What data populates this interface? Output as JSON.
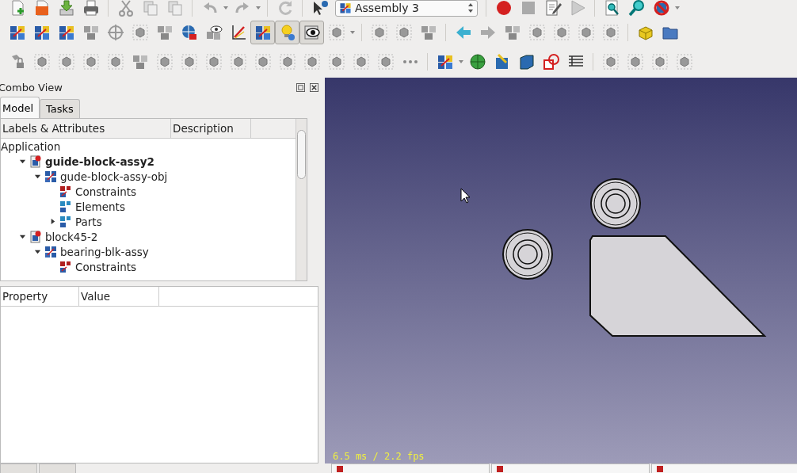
{
  "toolbars": [
    {
      "items": [
        {
          "kind": "new-document"
        },
        {
          "kind": "folder"
        },
        {
          "kind": "save"
        },
        {
          "kind": "printer"
        },
        {
          "kind": "separator"
        },
        {
          "kind": "scissors"
        },
        {
          "kind": "copy"
        },
        {
          "kind": "paste"
        },
        {
          "kind": "separator"
        },
        {
          "kind": "undo"
        },
        {
          "kind": "caret"
        },
        {
          "kind": "redo"
        },
        {
          "kind": "caret"
        },
        {
          "kind": "separator"
        },
        {
          "kind": "refresh"
        },
        {
          "kind": "separator"
        },
        {
          "kind": "pointer-question"
        },
        {
          "kind": "combo",
          "label": "Assembly 3"
        },
        {
          "kind": "separator"
        },
        {
          "kind": "record"
        },
        {
          "kind": "stop"
        },
        {
          "kind": "page-pencil"
        },
        {
          "kind": "play"
        },
        {
          "kind": "separator"
        },
        {
          "kind": "page-magnifier"
        },
        {
          "kind": "magnifier"
        },
        {
          "kind": "no-entry"
        },
        {
          "kind": "caret"
        }
      ]
    },
    {
      "items": [
        {
          "kind": "color-cubes",
          "pressed": false
        },
        {
          "kind": "color-cubes",
          "pressed": false
        },
        {
          "kind": "color-cubes",
          "pressed": false
        },
        {
          "kind": "gray-cubes",
          "pressed": false
        },
        {
          "kind": "crosshair",
          "pressed": false
        },
        {
          "kind": "gray-part",
          "pressed": false
        },
        {
          "kind": "gray-cubes",
          "pressed": false
        },
        {
          "kind": "globe-lock",
          "pressed": false
        },
        {
          "kind": "eye-cubes",
          "pressed": false
        },
        {
          "kind": "axis-pencil",
          "pressed": false
        },
        {
          "kind": "color-cubes",
          "pressed": true
        },
        {
          "kind": "bulb",
          "pressed": true
        },
        {
          "kind": "eye",
          "pressed": true
        },
        {
          "kind": "gray-part",
          "pressed": false
        },
        {
          "kind": "caret"
        },
        {
          "kind": "separator"
        },
        {
          "kind": "gray-part",
          "pressed": false
        },
        {
          "kind": "gray-part",
          "pressed": false
        },
        {
          "kind": "gray-cubes",
          "pressed": false
        },
        {
          "kind": "separator"
        },
        {
          "kind": "arrow-left",
          "pressed": false
        },
        {
          "kind": "arrow-right",
          "pressed": false
        },
        {
          "kind": "gray-cubes",
          "pressed": false
        },
        {
          "kind": "gray-part",
          "pressed": false
        },
        {
          "kind": "gray-part",
          "pressed": false
        },
        {
          "kind": "gray-part",
          "pressed": false
        },
        {
          "kind": "gray-part",
          "pressed": false
        },
        {
          "kind": "separator"
        },
        {
          "kind": "yellow-cube",
          "pressed": false
        },
        {
          "kind": "blue-folder",
          "pressed": false
        }
      ]
    },
    {
      "items": [
        {
          "kind": "gray-lock"
        },
        {
          "kind": "gray-part"
        },
        {
          "kind": "gray-part"
        },
        {
          "kind": "gray-part"
        },
        {
          "kind": "gray-part"
        },
        {
          "kind": "gray-cubes"
        },
        {
          "kind": "gray-part"
        },
        {
          "kind": "gray-part"
        },
        {
          "kind": "gray-part"
        },
        {
          "kind": "gray-part"
        },
        {
          "kind": "gray-part"
        },
        {
          "kind": "gray-part"
        },
        {
          "kind": "gray-part"
        },
        {
          "kind": "gray-part"
        },
        {
          "kind": "gray-part"
        },
        {
          "kind": "gray-part"
        },
        {
          "kind": "dots"
        },
        {
          "kind": "separator"
        },
        {
          "kind": "color-cubes"
        },
        {
          "kind": "caret"
        },
        {
          "kind": "green-sphere"
        },
        {
          "kind": "pencil-cube"
        },
        {
          "kind": "blue-cube"
        },
        {
          "kind": "red-shapes"
        },
        {
          "kind": "table"
        },
        {
          "kind": "separator"
        },
        {
          "kind": "gray-part"
        },
        {
          "kind": "gray-part"
        },
        {
          "kind": "gray-part"
        },
        {
          "kind": "gray-part"
        }
      ]
    }
  ],
  "combo_view": {
    "title": "Combo View",
    "tabs": [
      {
        "label": "Model",
        "selected": true
      },
      {
        "label": "Tasks",
        "selected": false
      }
    ],
    "tree": {
      "columns": [
        "Labels & Attributes",
        "Description"
      ],
      "items": [
        {
          "label": "Application",
          "active": false,
          "children": [
            {
              "label": "guide-block-assy2",
              "kind": "document",
              "expanded": true,
              "active": true,
              "children": [
                {
                  "label": "gude-block-assy-obj",
                  "kind": "assembly",
                  "expanded": true,
                  "active": false,
                  "children": [
                    {
                      "label": "Constraints",
                      "kind": "constraints",
                      "active": false
                    },
                    {
                      "label": "Elements",
                      "kind": "elements",
                      "active": false
                    },
                    {
                      "label": "Parts",
                      "kind": "elements",
                      "expanded": false,
                      "active": false
                    }
                  ]
                }
              ]
            },
            {
              "label": "block45-2",
              "kind": "document",
              "expanded": true,
              "active": false,
              "children": [
                {
                  "label": "bearing-blk-assy",
                  "kind": "assembly",
                  "expanded": true,
                  "active": false,
                  "children": [
                    {
                      "label": "Constraints",
                      "kind": "constraints",
                      "active": false
                    }
                  ]
                }
              ]
            }
          ]
        }
      ]
    },
    "property_columns": [
      "Property",
      "Value"
    ]
  },
  "viewport": {
    "fps": "6.5 ms / 2.2 fps"
  }
}
